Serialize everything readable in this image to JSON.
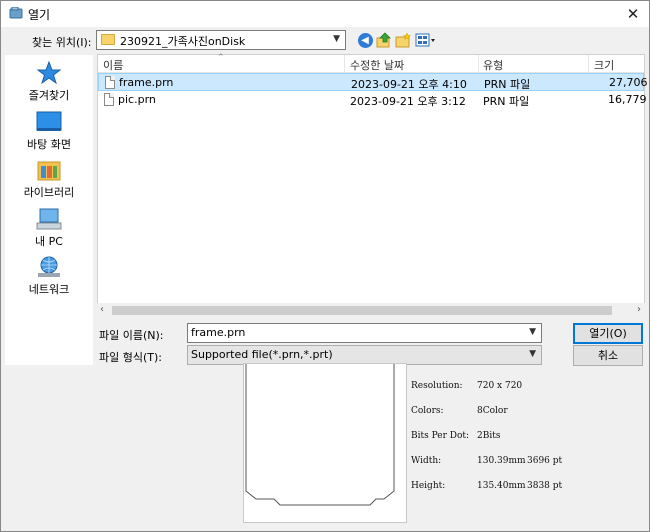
{
  "window": {
    "title": "열기",
    "close_glyph": "✕"
  },
  "lookin": {
    "label": "찾는 위치(I):",
    "value": "230921_가족사진onDisk"
  },
  "places": [
    {
      "label": "즐겨찾기"
    },
    {
      "label": "바탕 화면"
    },
    {
      "label": "라이브러리"
    },
    {
      "label": "내 PC"
    },
    {
      "label": "네트워크"
    }
  ],
  "columns": {
    "name": "이름",
    "date": "수정한 날짜",
    "type": "유형",
    "size": "크기"
  },
  "files": [
    {
      "name": "frame.prn",
      "date": "2023-09-21 오후 4:10",
      "type": "PRN 파일",
      "size": "27,706"
    },
    {
      "name": "pic.prn",
      "date": "2023-09-21 오후 3:12",
      "type": "PRN 파일",
      "size": "16,779"
    }
  ],
  "filename": {
    "label": "파일 이름(N):",
    "value": "frame.prn"
  },
  "filetype": {
    "label": "파일 형식(T):",
    "value": "Supported file(*.prn,*.prt)"
  },
  "buttons": {
    "open": "열기(O)",
    "cancel": "취소"
  },
  "file_info": {
    "resolution_label": "Resolution:",
    "resolution_value": "720 x 720",
    "colors_label": "Colors:",
    "colors_value": "8Color",
    "bpd_label": "Bits Per Dot:",
    "bpd_value": "2Bits",
    "width_label": "Width:",
    "width_mm": "130.39mm",
    "width_pt": "3696 pt",
    "height_label": "Height:",
    "height_mm": "135.40mm",
    "height_pt": "3838 pt"
  },
  "colors": {
    "selection": "#cce8ff",
    "accent": "#0078d7",
    "folder": "#f7d36b"
  }
}
